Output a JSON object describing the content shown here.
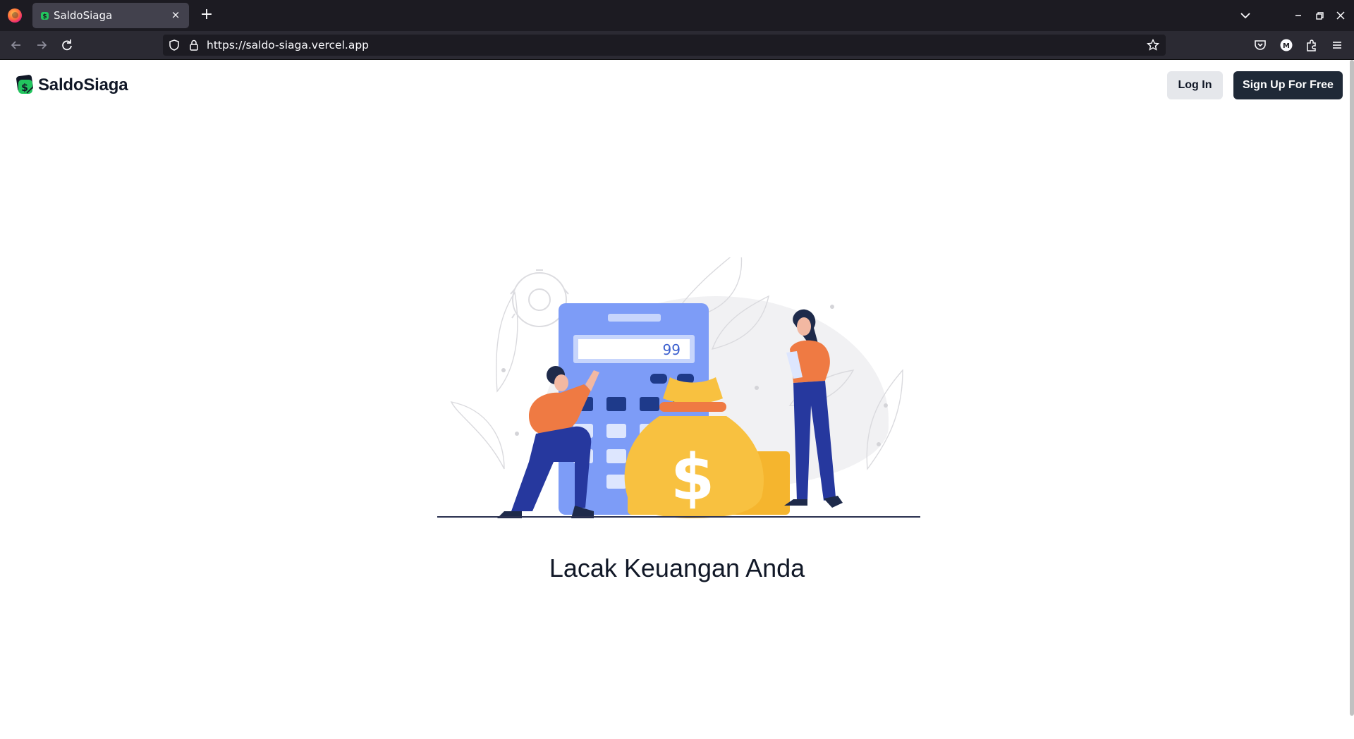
{
  "browser": {
    "tab_title": "SaldoSiaga",
    "url": "https://saldo-siaga.vercel.app",
    "new_tab_label": "+",
    "close_tab_label": "×"
  },
  "header": {
    "brand_name": "SaldoSiaga",
    "login_label": "Log In",
    "signup_label": "Sign Up For Free"
  },
  "hero": {
    "calculator_display": "99",
    "tagline": "Lacak Keuangan Anda"
  },
  "colors": {
    "brand_green": "#22c55e",
    "primary_dark": "#1f2937",
    "calculator_blue": "#7d9cf7",
    "accent_orange": "#ef7a43",
    "money_yellow": "#f8c140"
  }
}
